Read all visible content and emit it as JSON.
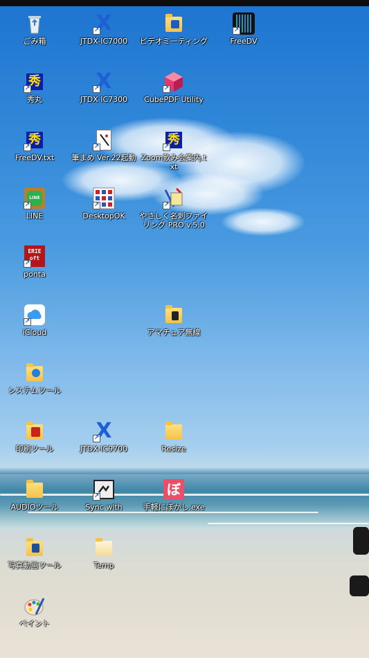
{
  "desktop": {
    "icons": [
      {
        "label": "ごみ箱",
        "icon": "recycle-bin-icon"
      },
      {
        "label": "JTDX-IC7000",
        "icon": "jtdx-icon"
      },
      {
        "label": "ビデオミーティング",
        "icon": "folder-icon"
      },
      {
        "label": "FreeDV",
        "icon": "freedv-icon"
      },
      {
        "label": "秀丸",
        "icon": "hidemaru-icon"
      },
      {
        "label": "JTDX-IC7300",
        "icon": "jtdx-icon"
      },
      {
        "label": "CubePDF Utility",
        "icon": "cubepdf-icon"
      },
      {
        "label": "FreeDV.txt",
        "icon": "hidemaru-icon"
      },
      {
        "label": "筆まめ Ver.22起動",
        "icon": "fudemame-icon"
      },
      {
        "label": "Zoom飲み会案内.txt",
        "icon": "hidemaru-icon"
      },
      {
        "label": "LINE",
        "icon": "line-icon"
      },
      {
        "label": "DesktopOK",
        "icon": "desktopok-icon"
      },
      {
        "label": "やさしく名刺ファイリング PRO v.5.0",
        "icon": "card-filing-icon"
      },
      {
        "label": "ponta",
        "icon": "ponta-icon"
      },
      {
        "label": "iCloud",
        "icon": "icloud-icon"
      },
      {
        "label": "アマチュア無線",
        "icon": "folder-icon"
      },
      {
        "label": "システムツール",
        "icon": "folder-icon"
      },
      {
        "label": "印刷ツール",
        "icon": "folder-icon"
      },
      {
        "label": "JTDX-IC9700",
        "icon": "jtdx-icon"
      },
      {
        "label": "Resize",
        "icon": "folder-icon"
      },
      {
        "label": "AUDIOツール",
        "icon": "folder-icon"
      },
      {
        "label": "Sync with",
        "icon": "sync-icon"
      },
      {
        "label": "手軽にぼかし.exe",
        "icon": "bokashi-icon"
      },
      {
        "label": "写真動画ツール",
        "icon": "folder-icon"
      },
      {
        "label": "Temp",
        "icon": "folder-icon"
      },
      {
        "label": "ペイント",
        "icon": "paint-icon"
      }
    ]
  },
  "shortcut_arrow": "↗",
  "hide_glyph": "秀",
  "jtdx_glyph": "X",
  "line_glyph": "LINE",
  "ponta_glyph": "ERIE oft",
  "bokashi_glyph": "ぼ"
}
